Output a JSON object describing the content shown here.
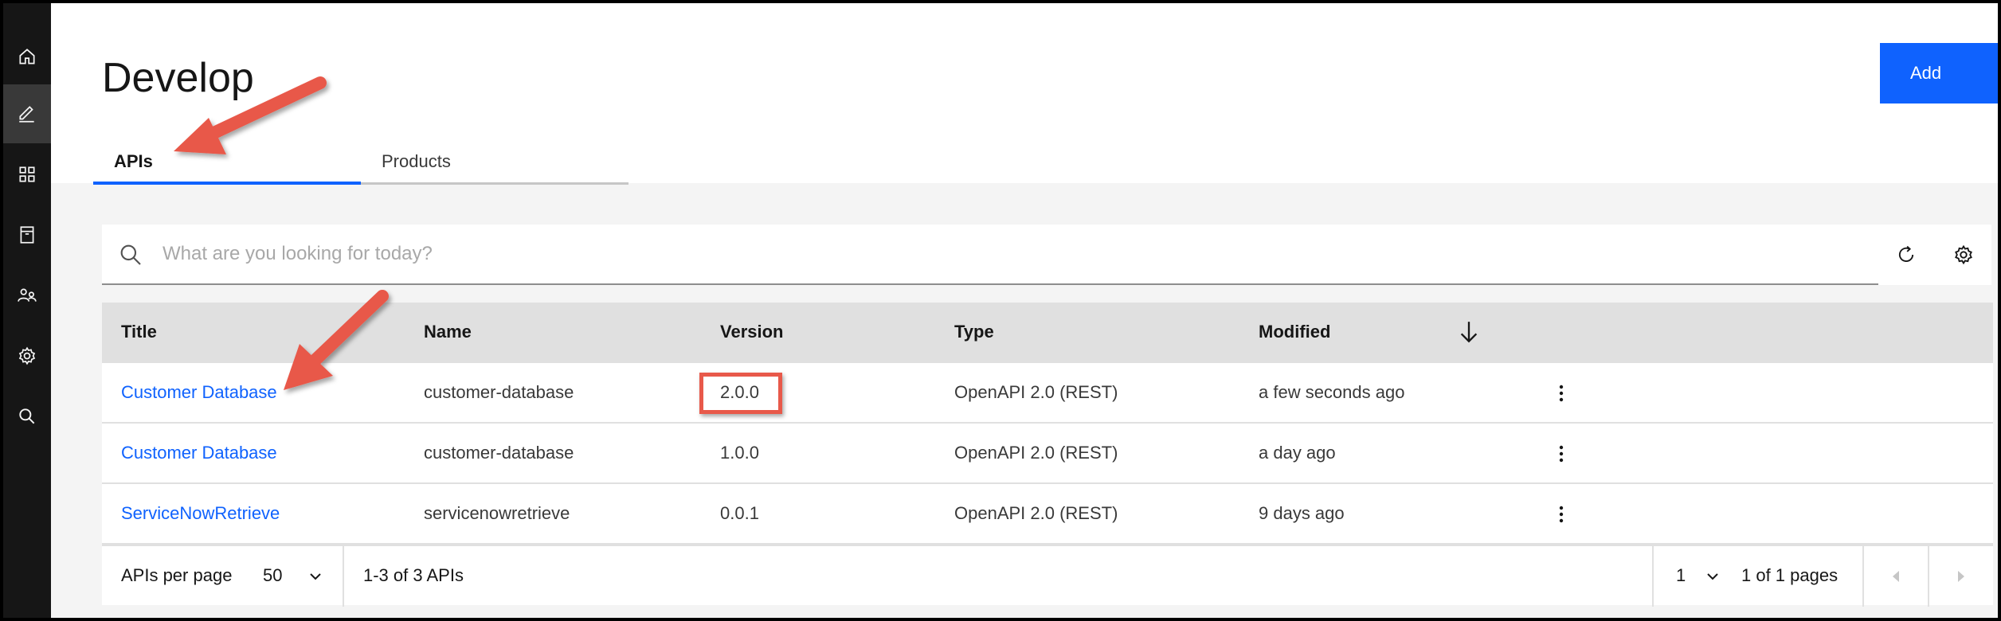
{
  "sidebar": {
    "items": [
      {
        "name": "home-icon"
      },
      {
        "name": "edit-icon"
      },
      {
        "name": "apps-grid-icon"
      },
      {
        "name": "catalog-icon"
      },
      {
        "name": "users-icon"
      },
      {
        "name": "settings-icon"
      },
      {
        "name": "search-icon"
      }
    ]
  },
  "header": {
    "title": "Develop",
    "add_label": "Add"
  },
  "tabs": [
    {
      "label": "APIs",
      "active": true
    },
    {
      "label": "Products",
      "active": false
    }
  ],
  "search": {
    "placeholder": "What are you looking for today?"
  },
  "table": {
    "columns": [
      "Title",
      "Name",
      "Version",
      "Type",
      "Modified"
    ],
    "sort": "descending",
    "rows": [
      {
        "title": "Customer Database",
        "name": "customer-database",
        "version": "2.0.0",
        "type": "OpenAPI 2.0 (REST)",
        "modified": "a few seconds ago"
      },
      {
        "title": "Customer Database",
        "name": "customer-database",
        "version": "1.0.0",
        "type": "OpenAPI 2.0 (REST)",
        "modified": "a day ago"
      },
      {
        "title": "ServiceNowRetrieve",
        "name": "servicenowretrieve",
        "version": "0.0.1",
        "type": "OpenAPI 2.0 (REST)",
        "modified": "9 days ago"
      }
    ]
  },
  "pagination": {
    "per_page_label": "APIs per page",
    "per_page_value": "50",
    "range_text": "1-3 of 3 APIs",
    "page_value": "1",
    "pages_text": "1 of 1 pages"
  },
  "colors": {
    "accent": "#0f62fe",
    "annotation": "#e8594a"
  }
}
